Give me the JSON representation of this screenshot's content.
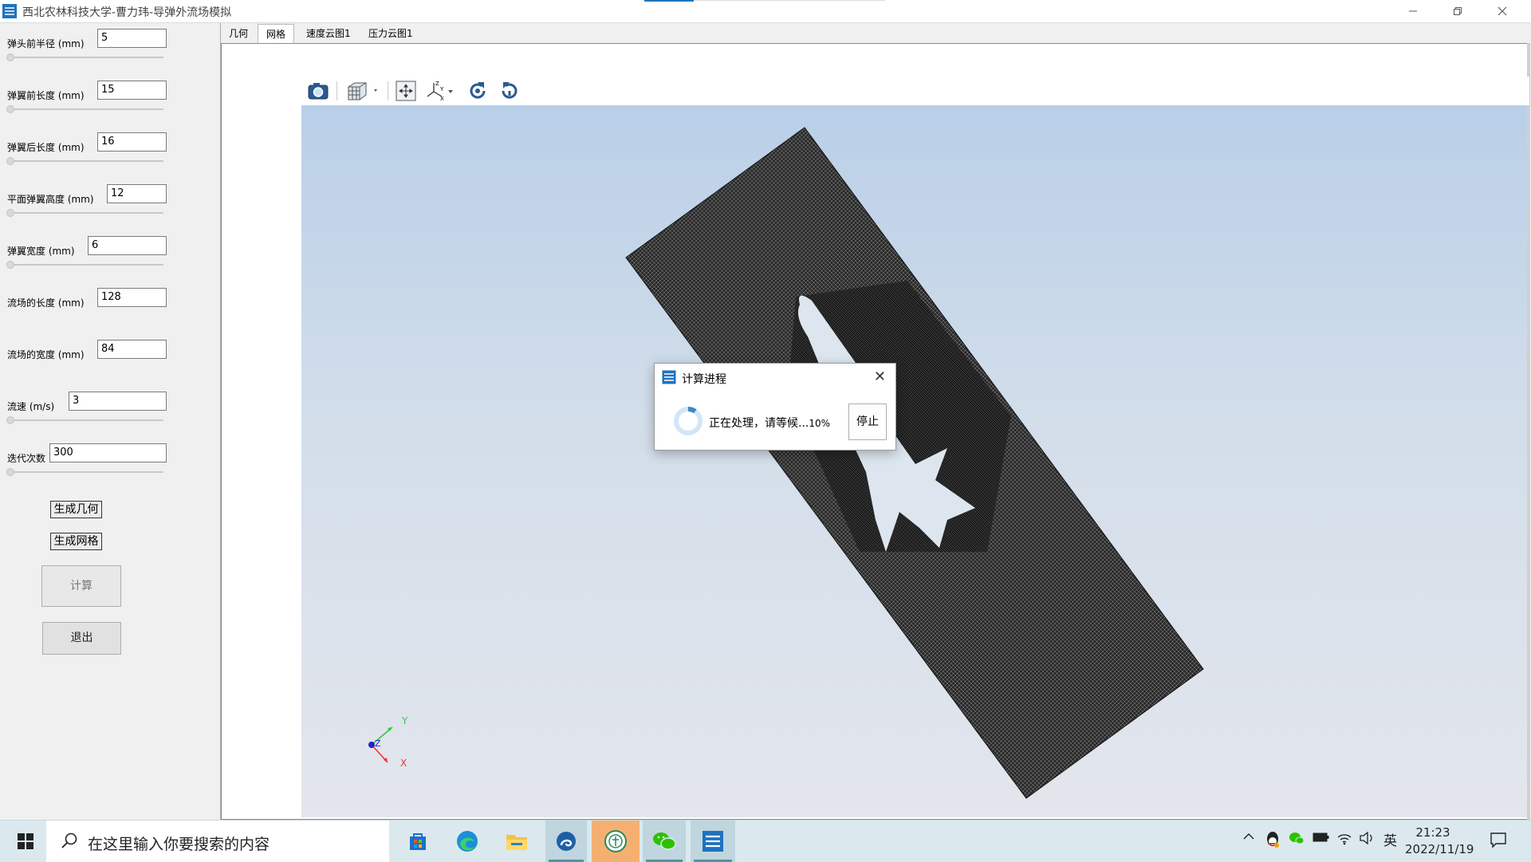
{
  "window": {
    "title": "西北农林科技大学-曹力玮-导弹外流场模拟"
  },
  "params": [
    {
      "label": "弹头前半径 (mm)",
      "value": "5"
    },
    {
      "label": "弹翼前长度 (mm)",
      "value": "15"
    },
    {
      "label": "弹翼后长度 (mm)",
      "value": "16"
    },
    {
      "label": "平面弹翼高度 (mm)",
      "value": "12"
    },
    {
      "label": "弹翼宽度 (mm)",
      "value": "6"
    },
    {
      "label": "流场的长度 (mm)",
      "value": "128"
    },
    {
      "label": "流场的宽度 (mm)",
      "value": "84"
    },
    {
      "label": "流速 (m/s)",
      "value": "3"
    },
    {
      "label": "迭代次数",
      "value": "300"
    }
  ],
  "buttons": {
    "gen_geometry": "生成几何",
    "gen_mesh": "生成网格",
    "compute": "计算",
    "exit": "退出"
  },
  "tabs": [
    "几何",
    "网格",
    "速度云图1",
    "压力云图1"
  ],
  "active_tab": "网格",
  "toolbar_icons": [
    "camera-icon",
    "view-cube-icon",
    "fit-view-icon",
    "axes-icon",
    "rotate-cw-icon",
    "rotate-ccw-icon"
  ],
  "axes": {
    "x": "X",
    "y": "Y",
    "z": "Z"
  },
  "dialog": {
    "title": "计算进程",
    "message": "正在处理，请等候...",
    "percent": "10%",
    "progress": 0.1,
    "stop_label": "停止"
  },
  "taskbar": {
    "search_placeholder": "在这里输入你要搜索的内容",
    "ime": "英",
    "time": "21:23",
    "date": "2022/11/19"
  },
  "colors": {
    "accent": "#1e73be",
    "taskbar_bg": "#dbe9ee",
    "highlight_app": "#f5b071"
  }
}
